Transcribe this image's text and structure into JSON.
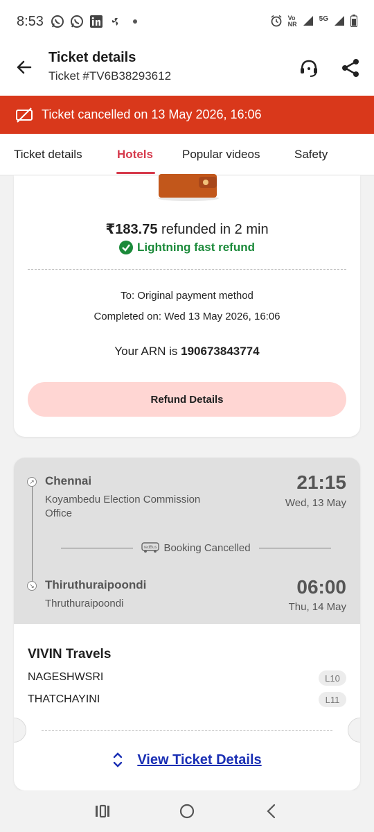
{
  "status_bar": {
    "time": "8:53",
    "left_icons": [
      "whatsapp-icon",
      "whatsapp-business-icon",
      "linkedin-icon",
      "fan-icon",
      "dot-icon"
    ],
    "right_icons": [
      "alarm-icon",
      "volte-icon",
      "signal-icon",
      "5g-signal-icon",
      "battery-icon"
    ],
    "network": "5G",
    "volte_label": "Vo",
    "nr_label": "NR"
  },
  "header": {
    "title": "Ticket details",
    "ticket_number": "Ticket #TV6B38293612"
  },
  "banner": {
    "text": "Ticket cancelled on 13 May 2026, 16:06",
    "color": "#d9381b"
  },
  "tabs": {
    "items": [
      "Ticket details",
      "Hotels",
      "Popular videos",
      "Safety"
    ],
    "active": "Hotels",
    "accent": "#d63a4c"
  },
  "refund": {
    "amount": "₹183.75",
    "amount_suffix": " refunded in 2 min",
    "badge": "Lightning fast refund",
    "to_label": "To: ",
    "to_value": "Original payment method",
    "completed_label": "Completed on: ",
    "completed_value": "Wed 13 May 2026, 16:06",
    "arn_label": "Your ARN is ",
    "arn_value": "190673843774",
    "button": "Refund Details"
  },
  "journey": {
    "from_city": "Chennai",
    "from_place": "Koyambedu Election Commission Office",
    "departure_time": "21:15",
    "departure_date": "Wed, 13 May",
    "status": "Booking Cancelled",
    "bus_logo_text": "redBus",
    "to_city": "Thiruthuraipoondi",
    "to_place": "Thruthuraipoondi",
    "arrival_time": "06:00",
    "arrival_date": "Thu, 14 May"
  },
  "operator": {
    "name": "VIVIN Travels",
    "passengers": [
      {
        "name": "NAGESHWSRI",
        "seat": "L10"
      },
      {
        "name": "THATCHAYINI",
        "seat": "L11"
      }
    ]
  },
  "view_details": "View Ticket Details",
  "nav": [
    "recents-icon",
    "home-icon",
    "back-nav-icon"
  ]
}
